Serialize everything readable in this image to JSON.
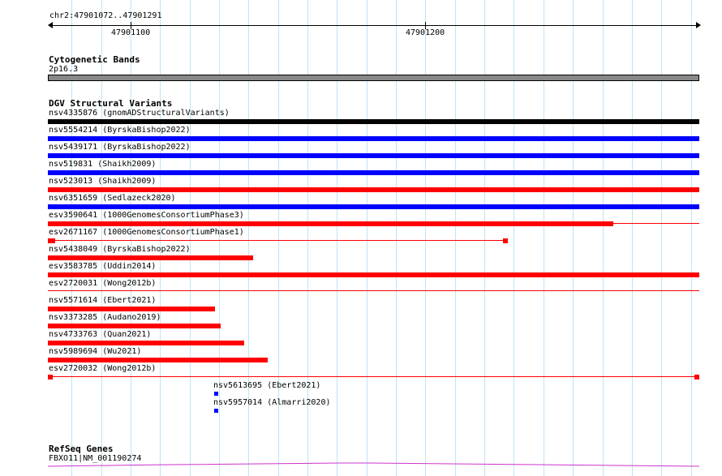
{
  "ruler": {
    "range_label": "chr2:47901072..47901291",
    "position_1": "47901100",
    "position_2": "47901200"
  },
  "tracks": {
    "cytogenetic": {
      "title": "Cytogenetic Bands",
      "band": "2p16.3",
      "bar_color": "#888888"
    },
    "dgv": {
      "title": "DGV Structural Variants",
      "colors": {
        "gain": "#0000ff",
        "loss": "#ff0000",
        "complex": "#000000"
      },
      "variants": [
        {
          "label": "nsv4335876 (gnomADStructuralVariants)"
        },
        {
          "label": "nsv5554214 (ByrskaBishop2022)"
        },
        {
          "label": "nsv5439171 (ByrskaBishop2022)"
        },
        {
          "label": "nsv519831 (Shaikh2009)"
        },
        {
          "label": "nsv523013 (Shaikh2009)"
        },
        {
          "label": "nsv6351659 (Sedlazeck2020)"
        },
        {
          "label": "esv3590641 (1000GenomesConsortiumPhase3)"
        },
        {
          "label": "esv2671167 (1000GenomesConsortiumPhase1)"
        },
        {
          "label": "nsv5438049 (ByrskaBishop2022)"
        },
        {
          "label": "esv3583785 (Uddin2014)"
        },
        {
          "label": "esv2720031 (Wong2012b)"
        },
        {
          "label": "nsv5571614 (Ebert2021)"
        },
        {
          "label": "nsv3373285 (Audano2019)"
        },
        {
          "label": "nsv4733763 (Quan2021)"
        },
        {
          "label": "nsv5989694 (Wu2021)"
        },
        {
          "label": "esv2720032 (Wong2012b)"
        },
        {
          "label": "nsv5613695 (Ebert2021)"
        },
        {
          "label": "nsv5957014 (Almarri2020)"
        }
      ]
    },
    "refseq": {
      "title": "RefSeq Genes",
      "gene_label": "FBXO11|NM_001190274",
      "gene_color": "#cc33cc"
    }
  }
}
